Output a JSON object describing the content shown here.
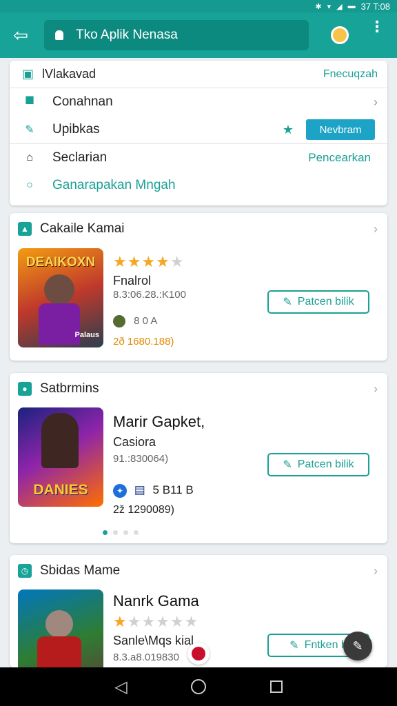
{
  "status": {
    "time": "37 T:08"
  },
  "header": {
    "search_text": "Tko Aplik Nenasa"
  },
  "menu": {
    "head_label": "lVlakavad",
    "head_link": "Fnecuqzah",
    "items": [
      {
        "label": "Conahnan",
        "icon": "location-pin-icon"
      },
      {
        "label": "Upibkas",
        "icon": "edit-icon",
        "button": "Nevbram"
      },
      {
        "label": "Seclarian",
        "icon": "home-outline-icon",
        "link": "Pencearkan"
      },
      {
        "label": "Ganarapakan Mngah",
        "icon": "circle-icon"
      }
    ]
  },
  "sections": [
    {
      "title": "Cakaile Kamai",
      "game": {
        "img_text_top": "DEAIKOXN",
        "img_text_bottom": "Palaus",
        "rating": 3.5,
        "title": "Fnalrol",
        "code": "8.3:06.28.:K100",
        "meta": "8 0 A",
        "count": "2ð 1680.188)",
        "button": "Patcen bilik"
      }
    },
    {
      "title": "Satbrmins",
      "game": {
        "img_text_bottom": "DANIES",
        "title": "Marir Gapket,",
        "subtitle": "Casiora",
        "code": "91.:830064)",
        "meta": "5 B11 B",
        "count": "2ž 1290089)",
        "button": "Patcen bilik"
      }
    },
    {
      "title": "Sbidas Mame",
      "game": {
        "title": "Nanrk Gama",
        "rating": 1,
        "subtitle": "Sanle\\Mqs kial",
        "code": "8.3.a8.019830",
        "button": "Fntken h"
      }
    }
  ],
  "colors": {
    "primary": "#17a398",
    "accent": "#1ca3c5",
    "star": "#f5a623"
  }
}
